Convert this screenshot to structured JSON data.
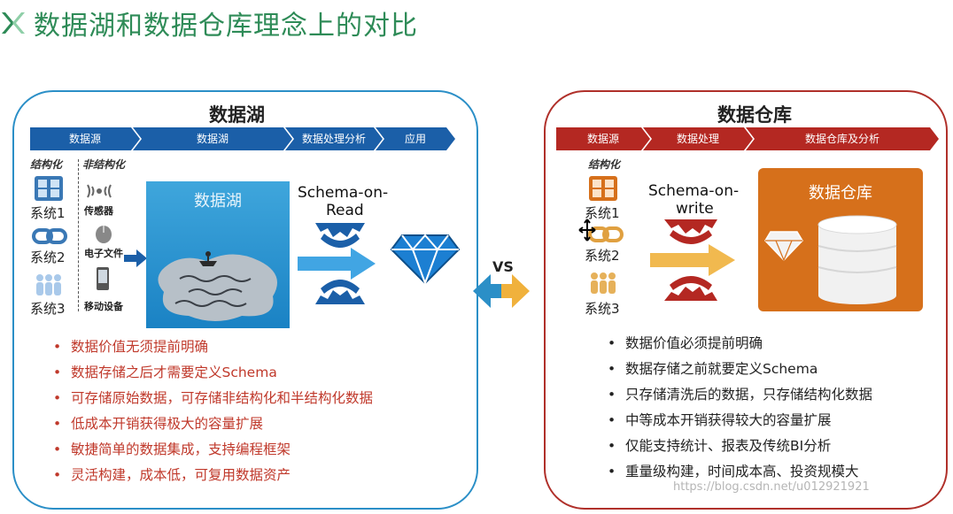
{
  "slide": {
    "title": "数据湖和数据仓库理念上的对比",
    "vs_label": "VS",
    "watermark": "https://blog.csdn.net/u012921921"
  },
  "lake_panel": {
    "title": "数据湖",
    "stages": [
      "数据源",
      "数据湖",
      "数据处理分析",
      "应用"
    ],
    "structured_label": "结构化",
    "unstructured_label": "非结构化",
    "systems": [
      "系统1",
      "系统2",
      "系统3"
    ],
    "devices": [
      "传感器",
      "电子文件",
      "移动设备"
    ],
    "lake_box_title": "数据湖",
    "schema_line1": "Schema-on-",
    "schema_line2": "Read",
    "bullets": [
      "数据价值无须提前明确",
      "数据存储之后才需要定义Schema",
      "可存储原始数据，可存储非结构化和半结构化数据",
      "低成本开销获得极大的容量扩展",
      "敏捷简单的数据集成，支持编程框架",
      "灵活构建，成本低，可复用数据资产"
    ]
  },
  "warehouse_panel": {
    "title": "数据仓库",
    "stages": [
      "数据源",
      "数据处理",
      "数据仓库及分析"
    ],
    "structured_label": "结构化",
    "systems": [
      "系统1",
      "系统2",
      "系统3"
    ],
    "warehouse_box_title": "数据仓库",
    "schema_line1": "Schema-on-",
    "schema_line2": "write",
    "bullets": [
      "数据价值必须提前明确",
      "数据存储之前就要定义Schema",
      "只存储清洗后的数据，只存储结构化数据",
      "中等成本开销获得较大的容量扩展",
      "仅能支持统计、报表及传统BI分析",
      "重量级构建，时间成本高、投资规模大"
    ]
  },
  "colors": {
    "title_green": "#2e8b57",
    "lake_blue": "#1b5fa8",
    "warehouse_red": "#b42822",
    "warehouse_orange": "#d6701b",
    "bullet_red": "#c0392b"
  }
}
